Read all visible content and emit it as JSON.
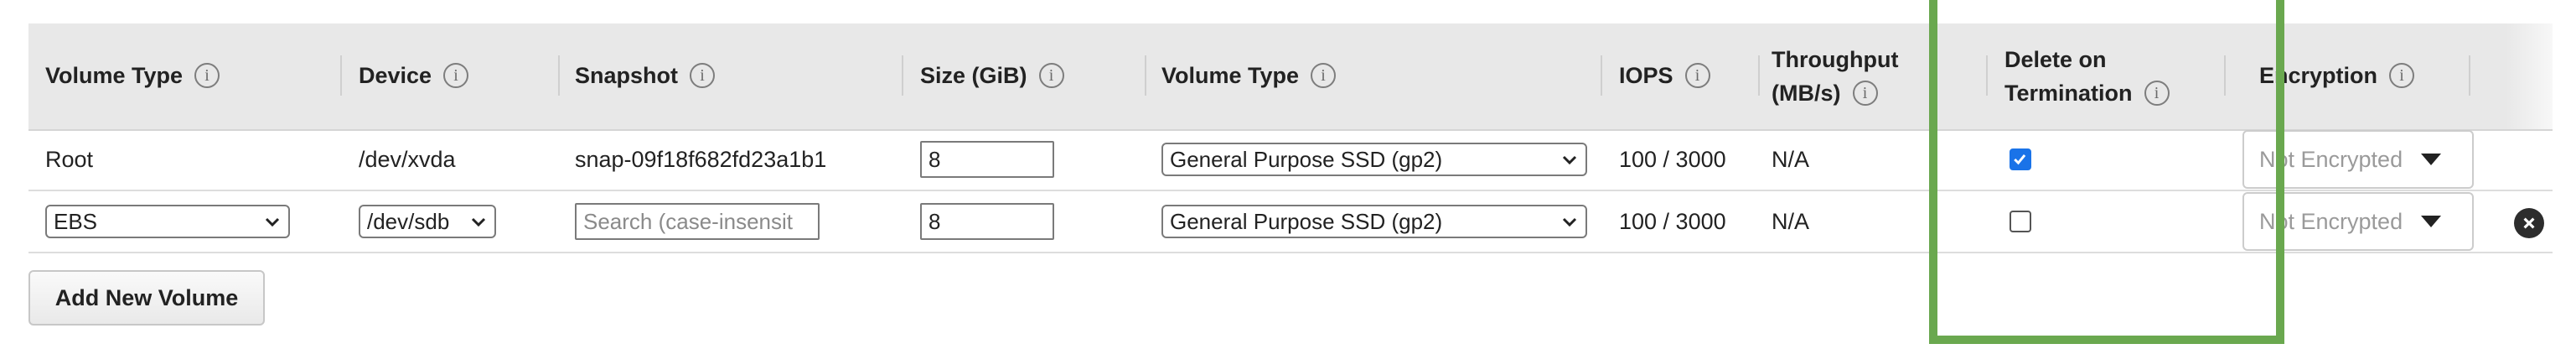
{
  "columns": [
    {
      "label": "Volume Type"
    },
    {
      "label": "Device"
    },
    {
      "label": "Snapshot"
    },
    {
      "label": "Size (GiB)"
    },
    {
      "label": "Volume Type"
    },
    {
      "label": "IOPS"
    },
    {
      "label_line1": "Throughput",
      "label_line2": "(MB/s)"
    },
    {
      "label_line1": "Delete on",
      "label_line2": "Termination"
    },
    {
      "label": "Encryption"
    }
  ],
  "rows": [
    {
      "volume_type": "Root",
      "device": "/dev/xvda",
      "snapshot": "snap-09f18f682fd23a1b1",
      "size": "8",
      "ebs_type": "General Purpose SSD (gp2)",
      "iops": "100 / 3000",
      "throughput": "N/A",
      "delete_on_termination": true,
      "encryption": "Not Encrypted"
    },
    {
      "volume_type": "EBS",
      "device": "/dev/sdb",
      "snapshot_placeholder": "Search (case-insensit",
      "size": "8",
      "ebs_type": "General Purpose SSD (gp2)",
      "iops": "100 / 3000",
      "throughput": "N/A",
      "delete_on_termination": false,
      "encryption": "Not Encrypted"
    }
  ],
  "add_button_label": "Add New Volume",
  "info_icon_glyph": "i",
  "highlight_color": "#6aa84f",
  "checkbox_checked_color": "#1a73e8"
}
